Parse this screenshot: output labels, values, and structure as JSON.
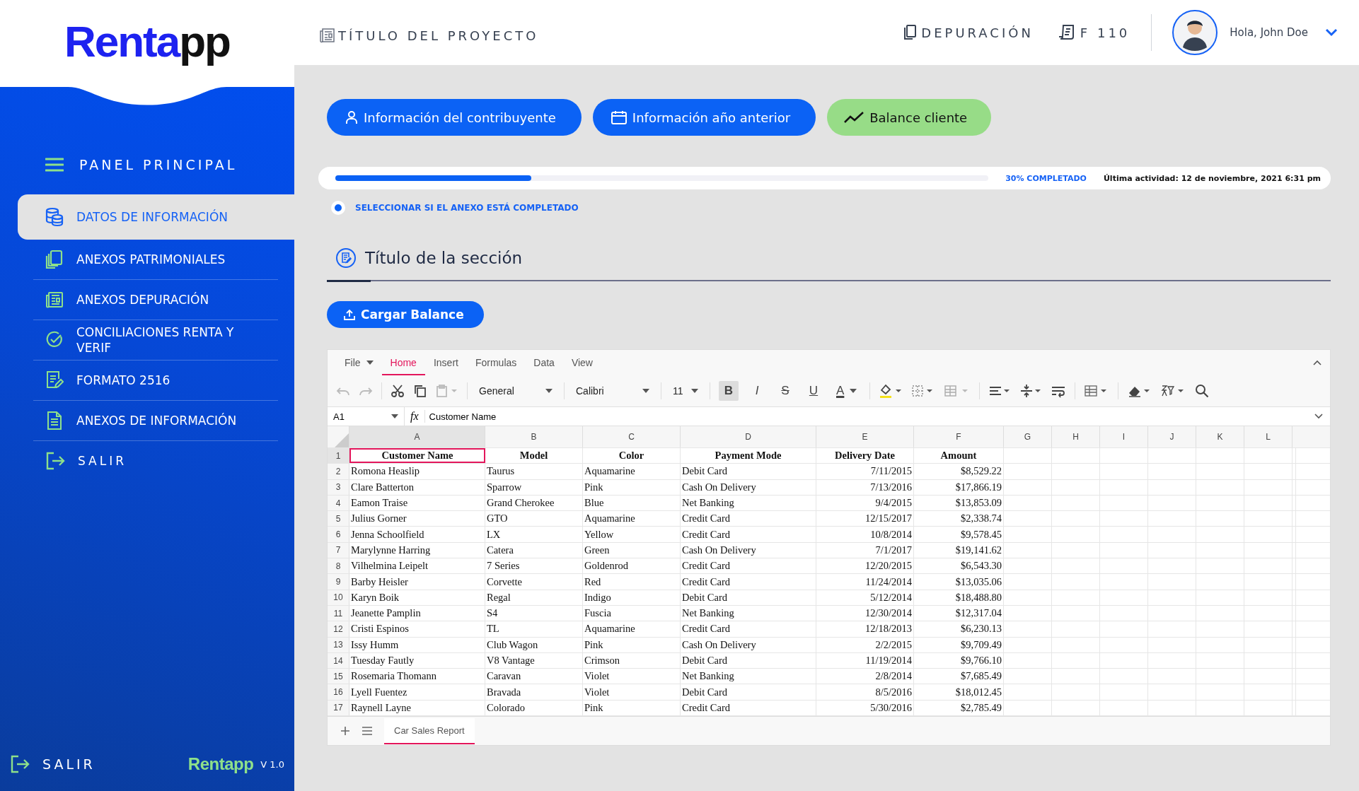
{
  "logo": {
    "first": "Renta",
    "second": "pp"
  },
  "sidebar": {
    "title": "PANEL PRINCIPAL",
    "items": [
      {
        "label": "DATOS DE INFORMACIÓN",
        "selected": true
      },
      {
        "label": "ANEXOS PATRIMONIALES",
        "selected": false
      },
      {
        "label": "ANEXOS DEPURACIÓN",
        "selected": false
      },
      {
        "label": "CONCILIACIONES RENTA Y VERIF",
        "selected": false
      },
      {
        "label": "FORMATO 2516",
        "selected": false
      },
      {
        "label": "ANEXOS DE INFORMACIÓN",
        "selected": false
      }
    ],
    "exit": "SALIR",
    "footer_exit": "SALIR",
    "footer_logo": "Rentapp",
    "version": "V 1.0"
  },
  "header": {
    "project_title": "TÍTULO DEL PROYECTO",
    "module": "DEPURACIÓN",
    "form": "F 110",
    "greeting": "Hola, John Doe"
  },
  "actions": [
    {
      "label": "Información del contribuyente",
      "selected": false
    },
    {
      "label": "Información año anterior",
      "selected": false
    },
    {
      "label": "Balance cliente",
      "selected": true
    }
  ],
  "progress": {
    "level": 0.3,
    "label": "30% COMPLETADO",
    "last_activity": "Última actividad: 12 de noviembre, 2021 6:31 pm"
  },
  "completed_radio": {
    "label": "SELECCIONAR SI EL ANEXO ESTÁ COMPLETADO",
    "selected": true
  },
  "section": {
    "title": "Título de la sección"
  },
  "upload_button": "Cargar Balance",
  "sheet": {
    "ribbon_tabs": [
      {
        "label": "File",
        "selected": false
      },
      {
        "label": "Home",
        "selected": true
      },
      {
        "label": "Insert",
        "selected": false
      },
      {
        "label": "Formulas",
        "selected": false
      },
      {
        "label": "Data",
        "selected": false
      },
      {
        "label": "View",
        "selected": false
      }
    ],
    "number_format": "General",
    "font": "Calibri",
    "font_size": "11",
    "format_buttons": [
      {
        "label": "B",
        "kind": "bold",
        "selected": true
      },
      {
        "label": "I",
        "kind": "italic",
        "selected": false
      },
      {
        "label": "S",
        "kind": "strike",
        "selected": false
      },
      {
        "label": "U",
        "kind": "underline",
        "selected": false
      },
      {
        "label": "A",
        "kind": "font-color",
        "selected": false
      }
    ],
    "name_box": "A1",
    "fx": "fx",
    "formula": "Customer Name",
    "columns": [
      {
        "letter": "A",
        "selected": true
      },
      {
        "letter": "B",
        "selected": false
      },
      {
        "letter": "C",
        "selected": false
      },
      {
        "letter": "D",
        "selected": false
      },
      {
        "letter": "E",
        "selected": false
      },
      {
        "letter": "F",
        "selected": false
      },
      {
        "letter": "G",
        "selected": false
      },
      {
        "letter": "H",
        "selected": false
      },
      {
        "letter": "I",
        "selected": false
      },
      {
        "letter": "J",
        "selected": false
      },
      {
        "letter": "K",
        "selected": false
      },
      {
        "letter": "L",
        "selected": false
      }
    ],
    "rows": [
      {
        "num": "1",
        "selected": true,
        "cells": [
          "Customer Name",
          "Model",
          "Color",
          "Payment Mode",
          "Delivery Date",
          "Amount"
        ]
      },
      {
        "num": "2",
        "selected": false,
        "cells": [
          "Romona Heaslip",
          "Taurus",
          "Aquamarine",
          "Debit Card",
          "7/11/2015",
          "$8,529.22"
        ]
      },
      {
        "num": "3",
        "selected": false,
        "cells": [
          "Clare Batterton",
          "Sparrow",
          "Pink",
          "Cash On Delivery",
          "7/13/2016",
          "$17,866.19"
        ]
      },
      {
        "num": "4",
        "selected": false,
        "cells": [
          "Eamon Traise",
          "Grand Cherokee",
          "Blue",
          "Net Banking",
          "9/4/2015",
          "$13,853.09"
        ]
      },
      {
        "num": "5",
        "selected": false,
        "cells": [
          "Julius Gorner",
          "GTO",
          "Aquamarine",
          "Credit Card",
          "12/15/2017",
          "$2,338.74"
        ]
      },
      {
        "num": "6",
        "selected": false,
        "cells": [
          "Jenna Schoolfield",
          "LX",
          "Yellow",
          "Credit Card",
          "10/8/2014",
          "$9,578.45"
        ]
      },
      {
        "num": "7",
        "selected": false,
        "cells": [
          "Marylynne Harring",
          "Catera",
          "Green",
          "Cash On Delivery",
          "7/1/2017",
          "$19,141.62"
        ]
      },
      {
        "num": "8",
        "selected": false,
        "cells": [
          "Vilhelmina Leipelt",
          "7 Series",
          "Goldenrod",
          "Credit Card",
          "12/20/2015",
          "$6,543.30"
        ]
      },
      {
        "num": "9",
        "selected": false,
        "cells": [
          "Barby Heisler",
          "Corvette",
          "Red",
          "Credit Card",
          "11/24/2014",
          "$13,035.06"
        ]
      },
      {
        "num": "10",
        "selected": false,
        "cells": [
          "Karyn Boik",
          "Regal",
          "Indigo",
          "Debit Card",
          "5/12/2014",
          "$18,488.80"
        ]
      },
      {
        "num": "11",
        "selected": false,
        "cells": [
          "Jeanette Pamplin",
          "S4",
          "Fuscia",
          "Net Banking",
          "12/30/2014",
          "$12,317.04"
        ]
      },
      {
        "num": "12",
        "selected": false,
        "cells": [
          "Cristi Espinos",
          "TL",
          "Aquamarine",
          "Credit Card",
          "12/18/2013",
          "$6,230.13"
        ]
      },
      {
        "num": "13",
        "selected": false,
        "cells": [
          "Issy Humm",
          "Club Wagon",
          "Pink",
          "Cash On Delivery",
          "2/2/2015",
          "$9,709.49"
        ]
      },
      {
        "num": "14",
        "selected": false,
        "cells": [
          "Tuesday Fautly",
          "V8 Vantage",
          "Crimson",
          "Debit Card",
          "11/19/2014",
          "$9,766.10"
        ]
      },
      {
        "num": "15",
        "selected": false,
        "cells": [
          "Rosemaria Thomann",
          "Caravan",
          "Violet",
          "Net Banking",
          "2/8/2014",
          "$7,685.49"
        ]
      },
      {
        "num": "16",
        "selected": false,
        "cells": [
          "Lyell Fuentez",
          "Bravada",
          "Violet",
          "Debit Card",
          "8/5/2016",
          "$18,012.45"
        ]
      },
      {
        "num": "17",
        "selected": false,
        "cells": [
          "Raynell Layne",
          "Colorado",
          "Pink",
          "Credit Card",
          "5/30/2016",
          "$2,785.49"
        ]
      }
    ],
    "sheet_tabs": [
      {
        "label": "Car Sales Report",
        "selected": true
      }
    ]
  }
}
